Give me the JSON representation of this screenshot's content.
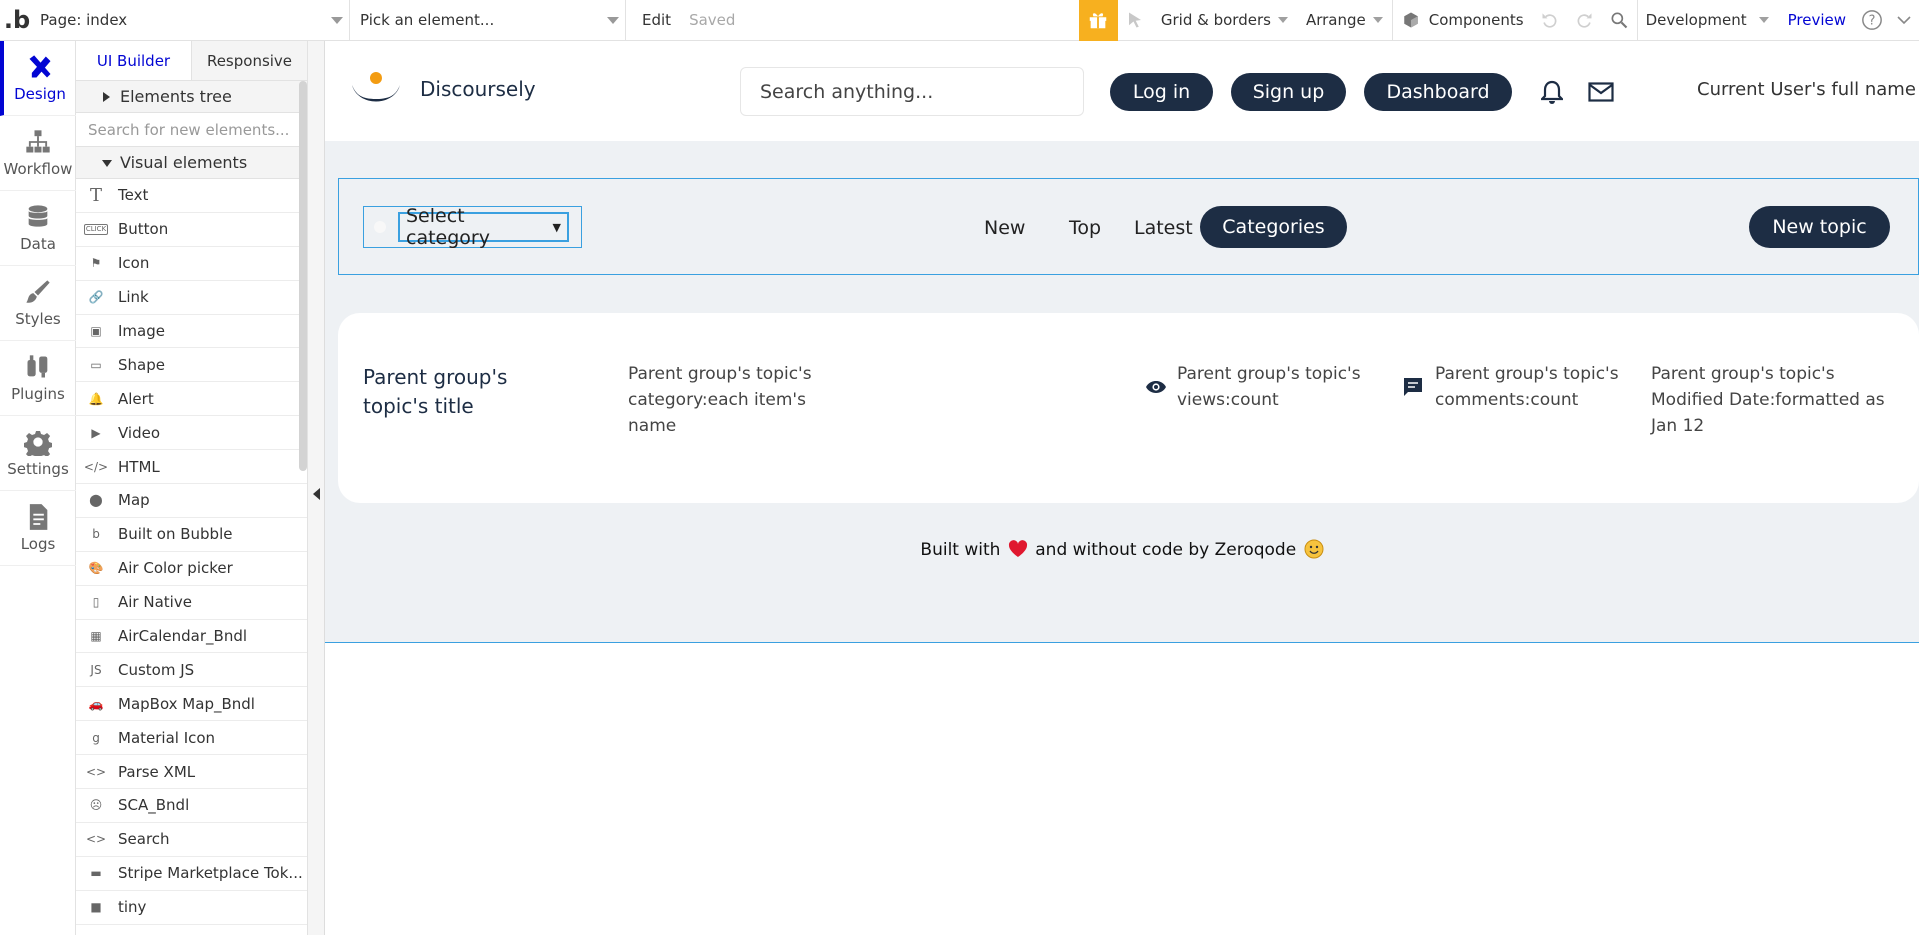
{
  "topbar": {
    "page_selector": "Page: index",
    "element_picker": "Pick an element...",
    "edit": "Edit",
    "saved": "Saved",
    "grid_borders": "Grid & borders",
    "arrange": "Arrange",
    "components": "Components",
    "environment": "Development",
    "preview": "Preview",
    "accent_color": "#f7b01f"
  },
  "rail": {
    "items": [
      {
        "label": "Design",
        "icon": "design-icon"
      },
      {
        "label": "Workflow",
        "icon": "workflow-icon"
      },
      {
        "label": "Data",
        "icon": "database-icon"
      },
      {
        "label": "Styles",
        "icon": "brush-icon"
      },
      {
        "label": "Plugins",
        "icon": "plug-icon"
      },
      {
        "label": "Settings",
        "icon": "gear-icon"
      },
      {
        "label": "Logs",
        "icon": "document-icon"
      }
    ]
  },
  "palette": {
    "tabs": [
      "UI Builder",
      "Responsive"
    ],
    "elements_tree": "Elements tree",
    "search_placeholder": "Search for new elements...",
    "visual_elements": "Visual elements",
    "items": [
      {
        "label": "Text",
        "icon": "T"
      },
      {
        "label": "Button",
        "icon": "CLICK"
      },
      {
        "label": "Icon",
        "icon": "⚑"
      },
      {
        "label": "Link",
        "icon": "🔗"
      },
      {
        "label": "Image",
        "icon": "▣"
      },
      {
        "label": "Shape",
        "icon": "▭"
      },
      {
        "label": "Alert",
        "icon": "🔔"
      },
      {
        "label": "Video",
        "icon": "▶"
      },
      {
        "label": "HTML",
        "icon": "</>"
      },
      {
        "label": "Map",
        "icon": "⬤"
      },
      {
        "label": "Built on Bubble",
        "icon": "b"
      },
      {
        "label": "Air Color picker",
        "icon": "🎨"
      },
      {
        "label": "Air Native",
        "icon": "▯"
      },
      {
        "label": "AirCalendar_Bndl",
        "icon": "▦"
      },
      {
        "label": "Custom JS",
        "icon": "JS"
      },
      {
        "label": "MapBox Map_Bndl",
        "icon": "🚗"
      },
      {
        "label": "Material Icon",
        "icon": "g"
      },
      {
        "label": "Parse XML",
        "icon": "<>"
      },
      {
        "label": "SCA_Bndl",
        "icon": "☹"
      },
      {
        "label": "Search",
        "icon": "<>"
      },
      {
        "label": "Stripe Marketplace Tok...",
        "icon": "▬"
      },
      {
        "label": "tiny",
        "icon": "■"
      }
    ]
  },
  "app": {
    "brand": "Discoursely",
    "search_placeholder": "Search anything...",
    "login": "Log in",
    "signup": "Sign up",
    "dashboard": "Dashboard",
    "user_name": "Current User's full name",
    "primary_color": "#1d2d44",
    "category_select": "Select category",
    "nav": [
      "New",
      "Top",
      "Latest"
    ],
    "categories": "Categories",
    "new_topic": "New topic",
    "topic": {
      "title": "Parent group's topic's title",
      "category": "Parent group's topic's category:each item's name",
      "views": "Parent group's topic's views:count",
      "comments": "Parent group's topic's comments:count",
      "modified": "Parent group's topic's Modified Date:formatted as Jan 12"
    },
    "footer_before": "Built with",
    "footer_after": "and without code by Zeroqode"
  }
}
